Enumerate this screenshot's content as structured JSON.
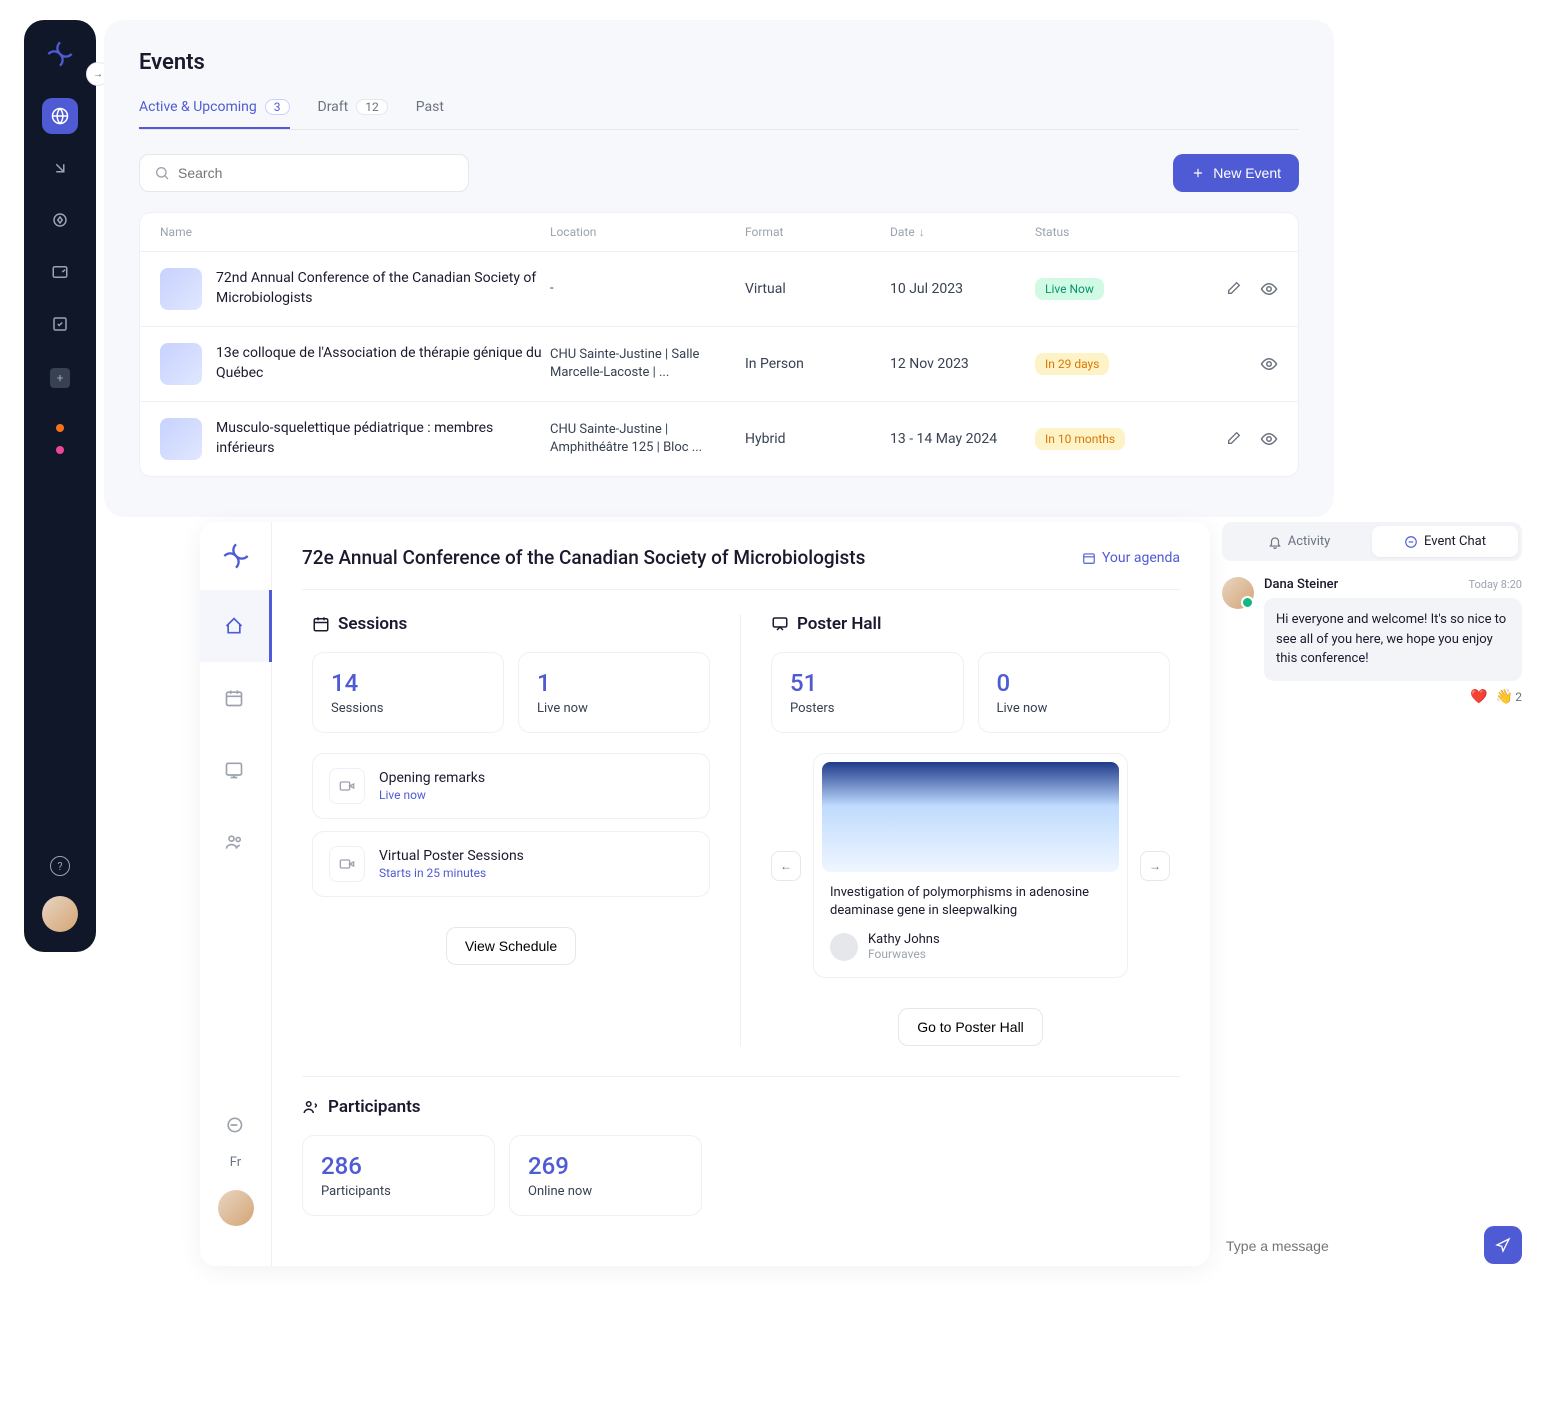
{
  "page": {
    "title": "Events"
  },
  "tabs": [
    {
      "label": "Active & Upcoming",
      "count": "3",
      "active": true
    },
    {
      "label": "Draft",
      "count": "12",
      "active": false
    },
    {
      "label": "Past",
      "active": false
    }
  ],
  "search": {
    "placeholder": "Search"
  },
  "new_event_btn": "New Event",
  "columns": {
    "name": "Name",
    "location": "Location",
    "format": "Format",
    "date": "Date",
    "status": "Status"
  },
  "events": [
    {
      "name": "72nd Annual Conference of the Canadian Society of Microbiologists",
      "location": "-",
      "format": "Virtual",
      "date": "10 Jul 2023",
      "status": "Live Now",
      "status_class": "status-live",
      "editable": true
    },
    {
      "name": "13e colloque de l'Association de thérapie génique du Québec",
      "location": "CHU Sainte-Justine | Salle Marcelle-Lacoste | ...",
      "format": "In Person",
      "date": "12 Nov 2023",
      "status": "In 29 days",
      "status_class": "status-upcoming",
      "editable": false
    },
    {
      "name": "Musculo-squelettique pédiatrique : membres inférieurs",
      "location": "CHU Sainte-Justine | Amphithéâtre 125 | Bloc ...",
      "format": "Hybrid",
      "date": "13 - 14 May 2024",
      "status": "In 10 months",
      "status_class": "status-upcoming",
      "editable": true
    }
  ],
  "detail": {
    "title": "72e Annual Conference of the Canadian Society of Microbiologists",
    "agenda_link": "Your agenda",
    "lang": "Fr",
    "sessions": {
      "title": "Sessions",
      "stats": [
        {
          "num": "14",
          "label": "Sessions"
        },
        {
          "num": "1",
          "label": "Live now"
        }
      ],
      "items": [
        {
          "name": "Opening remarks",
          "status": "Live now"
        },
        {
          "name": "Virtual Poster Sessions",
          "status": "Starts in 25 minutes"
        }
      ],
      "view_btn": "View Schedule"
    },
    "posters": {
      "title": "Poster Hall",
      "stats": [
        {
          "num": "51",
          "label": "Posters"
        },
        {
          "num": "0",
          "label": "Live now"
        }
      ],
      "poster": {
        "title": "Investigation of polymorphisms in adenosine deaminase gene in sleepwalking",
        "author": "Kathy Johns",
        "org": "Fourwaves"
      },
      "view_btn": "Go to Poster Hall"
    },
    "participants": {
      "title": "Participants",
      "stats": [
        {
          "num": "286",
          "label": "Participants"
        },
        {
          "num": "269",
          "label": "Online now"
        }
      ]
    }
  },
  "chat": {
    "tabs": {
      "activity": "Activity",
      "chat": "Event Chat"
    },
    "msg": {
      "name": "Dana Steiner",
      "time": "Today 8:20",
      "text": "Hi everyone and welcome! It's so nice to see all of you here, we hope you enjoy this conference!"
    },
    "reactions": [
      {
        "emoji": "❤️",
        "count": ""
      },
      {
        "emoji": "👋",
        "count": "2"
      }
    ],
    "input_placeholder": "Type a message"
  }
}
